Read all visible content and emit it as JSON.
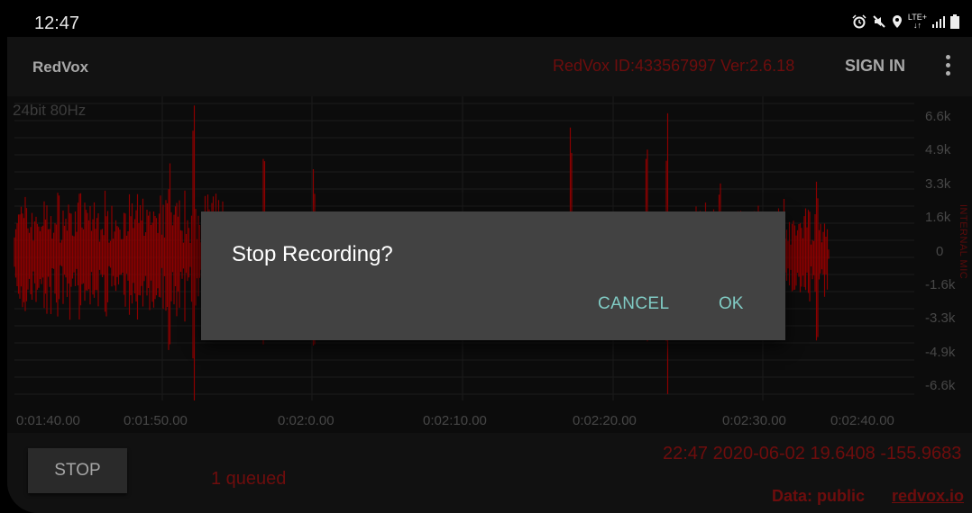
{
  "status_bar": {
    "time": "12:47",
    "icons": [
      "alarm-icon",
      "mute-icon",
      "location-icon",
      "lte-icon",
      "signal-icon",
      "battery-icon"
    ],
    "lte_top": "LTE+",
    "lte_bottom": "↓↑"
  },
  "app_bar": {
    "title": "RedVox",
    "station_info": "RedVox ID:433567997 Ver:2.6.18",
    "sign_in_label": "SIGN IN",
    "menu_icon": "more-vert-icon"
  },
  "plot": {
    "sample_label": "24bit 80Hz",
    "y_ticks": [
      "6.6k",
      "4.9k",
      "3.3k",
      "1.6k",
      "0",
      "-1.6k",
      "-3.3k",
      "-4.9k",
      "-6.6k"
    ],
    "x_ticks": [
      "0:01:40.00",
      "0:01:50.00",
      "0:02:0.00",
      "0:02:10.00",
      "0:02:20.00",
      "0:02:30.00",
      "0:02:40.00"
    ],
    "mic_label": "INTERNAL MIC",
    "waveform_color": "#8b0000"
  },
  "dialog": {
    "title": "Stop Recording?",
    "cancel_label": "CANCEL",
    "ok_label": "OK",
    "accent_color": "#80cbc4"
  },
  "bottom_bar": {
    "stop_label": "STOP",
    "queued_text": "1 queued",
    "gps_info": "22:47 2020-06-02  19.6408 -155.9683",
    "data_label": "Data: public",
    "link_text": "redvox.io"
  }
}
